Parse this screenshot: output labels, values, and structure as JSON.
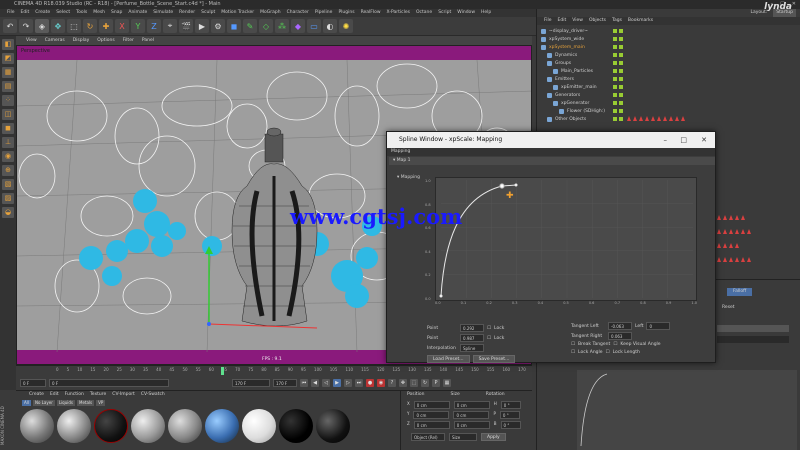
{
  "window": {
    "title": "CINEMA 4D R18.039 Studio (RC - R18) - [Perfume_Bottle_Scene_Start.c4d *] - Main",
    "logo_text": "lynda"
  },
  "menubar": [
    "File",
    "Edit",
    "Create",
    "Select",
    "Tools",
    "Mesh",
    "Snap",
    "Animate",
    "Simulate",
    "Render",
    "Sculpt",
    "Motion Tracker",
    "MoGraph",
    "Character",
    "Pipeline",
    "Plugins",
    "RealFlow",
    "X-Particles",
    "Octane",
    "Script",
    "Window",
    "Help"
  ],
  "layout": {
    "label": "Layout:",
    "value": "Startup"
  },
  "viewport": {
    "menu": [
      "View",
      "Cameras",
      "Display",
      "Options",
      "Filter",
      "Panel"
    ],
    "label": "Perspective",
    "fps": "FPS : 9.1",
    "sphere_color": "#2fb9e4",
    "bg_color": "#9e9e9e",
    "band_color": "#8a1a7c"
  },
  "timeline": {
    "ticks": [
      "0",
      "5",
      "10",
      "15",
      "20",
      "25",
      "30",
      "35",
      "40",
      "45",
      "50",
      "55",
      "60",
      "65",
      "70",
      "75",
      "80",
      "85",
      "90",
      "95",
      "100",
      "105",
      "110",
      "115",
      "120",
      "125",
      "130",
      "135",
      "140",
      "145",
      "150",
      "155",
      "160",
      "170"
    ],
    "start": "0 F",
    "current": "0 F",
    "end": "170 F",
    "end2": "170 F",
    "frame_label": "35 F"
  },
  "materials": {
    "menu": [
      "Create",
      "Edit",
      "Function",
      "Texture",
      "CV-Import",
      "CV-Swatch"
    ],
    "filters": [
      "All",
      "No Layer",
      "Liquids",
      "Metals",
      "VP"
    ]
  },
  "coords": {
    "headers": [
      "Position",
      "Size",
      "Rotation"
    ],
    "rows": [
      {
        "axis": "X",
        "pos": "0 cm",
        "size": "0 cm",
        "rot_axis": "H",
        "rot": "0 °"
      },
      {
        "axis": "Y",
        "pos": "0 cm",
        "size": "0 cm",
        "rot_axis": "P",
        "rot": "0 °"
      },
      {
        "axis": "Z",
        "pos": "0 cm",
        "size": "0 cm",
        "rot_axis": "B",
        "rot": "0 °"
      }
    ],
    "mode": "Object (Rel)",
    "size_mode": "Size",
    "apply": "Apply"
  },
  "objects": {
    "menu": [
      "File",
      "Edit",
      "View",
      "Objects",
      "Tags",
      "Bookmarks"
    ],
    "items": [
      {
        "label": "~display_driver~",
        "indent": 0,
        "selected": false
      },
      {
        "label": "xpSystem_wide",
        "indent": 0,
        "selected": false
      },
      {
        "label": "xpSystem_main",
        "indent": 0,
        "selected": true
      },
      {
        "label": "Dynamics",
        "indent": 1,
        "selected": false
      },
      {
        "label": "Groups",
        "indent": 1,
        "selected": false
      },
      {
        "label": "Main_Particles",
        "indent": 2,
        "selected": false
      },
      {
        "label": "Emitters",
        "indent": 1,
        "selected": false
      },
      {
        "label": "xpEmitter_main",
        "indent": 2,
        "selected": false
      },
      {
        "label": "Generators",
        "indent": 1,
        "selected": false
      },
      {
        "label": "xpGenerator",
        "indent": 2,
        "selected": false
      },
      {
        "label": "Flower (SDHigh:)",
        "indent": 3,
        "selected": false
      },
      {
        "label": "Other Objects",
        "indent": 1,
        "selected": false
      }
    ]
  },
  "attributes": {
    "falloff_tab": "Falloff",
    "reset": "Reset"
  },
  "spline_window": {
    "title": "Spline Window - xpScale: Mapping",
    "section": "Mapping",
    "map": "Map 1",
    "graph_label": "Mapping",
    "curve_color": "#e8e8e8",
    "ticks_x": [
      "0.0",
      "0.1",
      "0.2",
      "0.3",
      "0.4",
      "0.5",
      "0.6",
      "0.7",
      "0.8",
      "0.9",
      "1.0"
    ],
    "ticks_y": [
      "1.0",
      "0.8",
      "0.6",
      "0.4",
      "0.2",
      "0.0"
    ],
    "point_label": "Point",
    "point_x": "0.292",
    "point_y": "0.987",
    "lock": "Lock",
    "interpolation_label": "Interpolation",
    "interpolation": "Spline",
    "tangent_left_label": "Tangent Left",
    "tangent_left": "-0.063",
    "tangent_right_label": "Tangent Right",
    "tangent_right": "0.063",
    "length_label": "Left",
    "length_value": "0",
    "break_tangent": "Break Tangent",
    "keep_visual_angle": "Keep Visual Angle",
    "lock_angle": "Lock Angle",
    "lock_length": "Lock Length",
    "load_preset": "Load Preset...",
    "save_preset": "Save Preset..."
  },
  "watermark": "www.cgtsj.com",
  "brand_vertical": "MAXON CINEMA 4D"
}
